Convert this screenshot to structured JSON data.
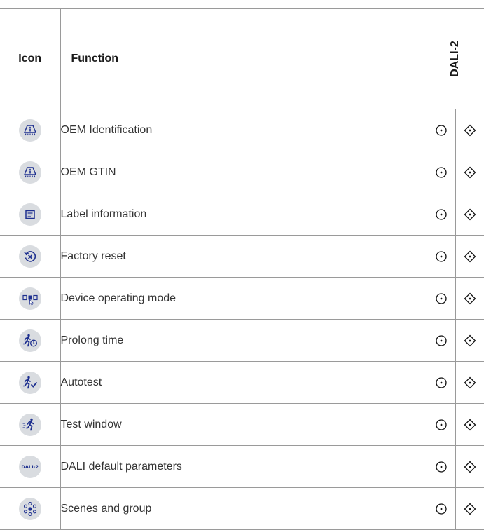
{
  "header": {
    "icon_label": "Icon",
    "function_label": "Function",
    "dali_label": "DALI-2"
  },
  "icon_color": "#1d2f8f",
  "icon_bg": "#d9dce0",
  "rows": [
    {
      "icon": "oem-identification-icon",
      "label": "OEM Identification"
    },
    {
      "icon": "oem-gtin-icon",
      "label": "OEM GTIN"
    },
    {
      "icon": "label-information-icon",
      "label": "Label information"
    },
    {
      "icon": "factory-reset-icon",
      "label": "Factory reset"
    },
    {
      "icon": "device-operating-mode-icon",
      "label": "Device operating mode"
    },
    {
      "icon": "prolong-time-icon",
      "label": "Prolong time"
    },
    {
      "icon": "autotest-icon",
      "label": "Autotest"
    },
    {
      "icon": "test-window-icon",
      "label": "Test window"
    },
    {
      "icon": "dali-default-parameters-icon",
      "label": "DALI default parameters",
      "icon_text": "DALI-2"
    },
    {
      "icon": "scenes-and-group-icon",
      "label": "Scenes and group"
    }
  ],
  "markers": {
    "col1": "circle-dot-icon",
    "col2": "diamond-dot-icon"
  }
}
